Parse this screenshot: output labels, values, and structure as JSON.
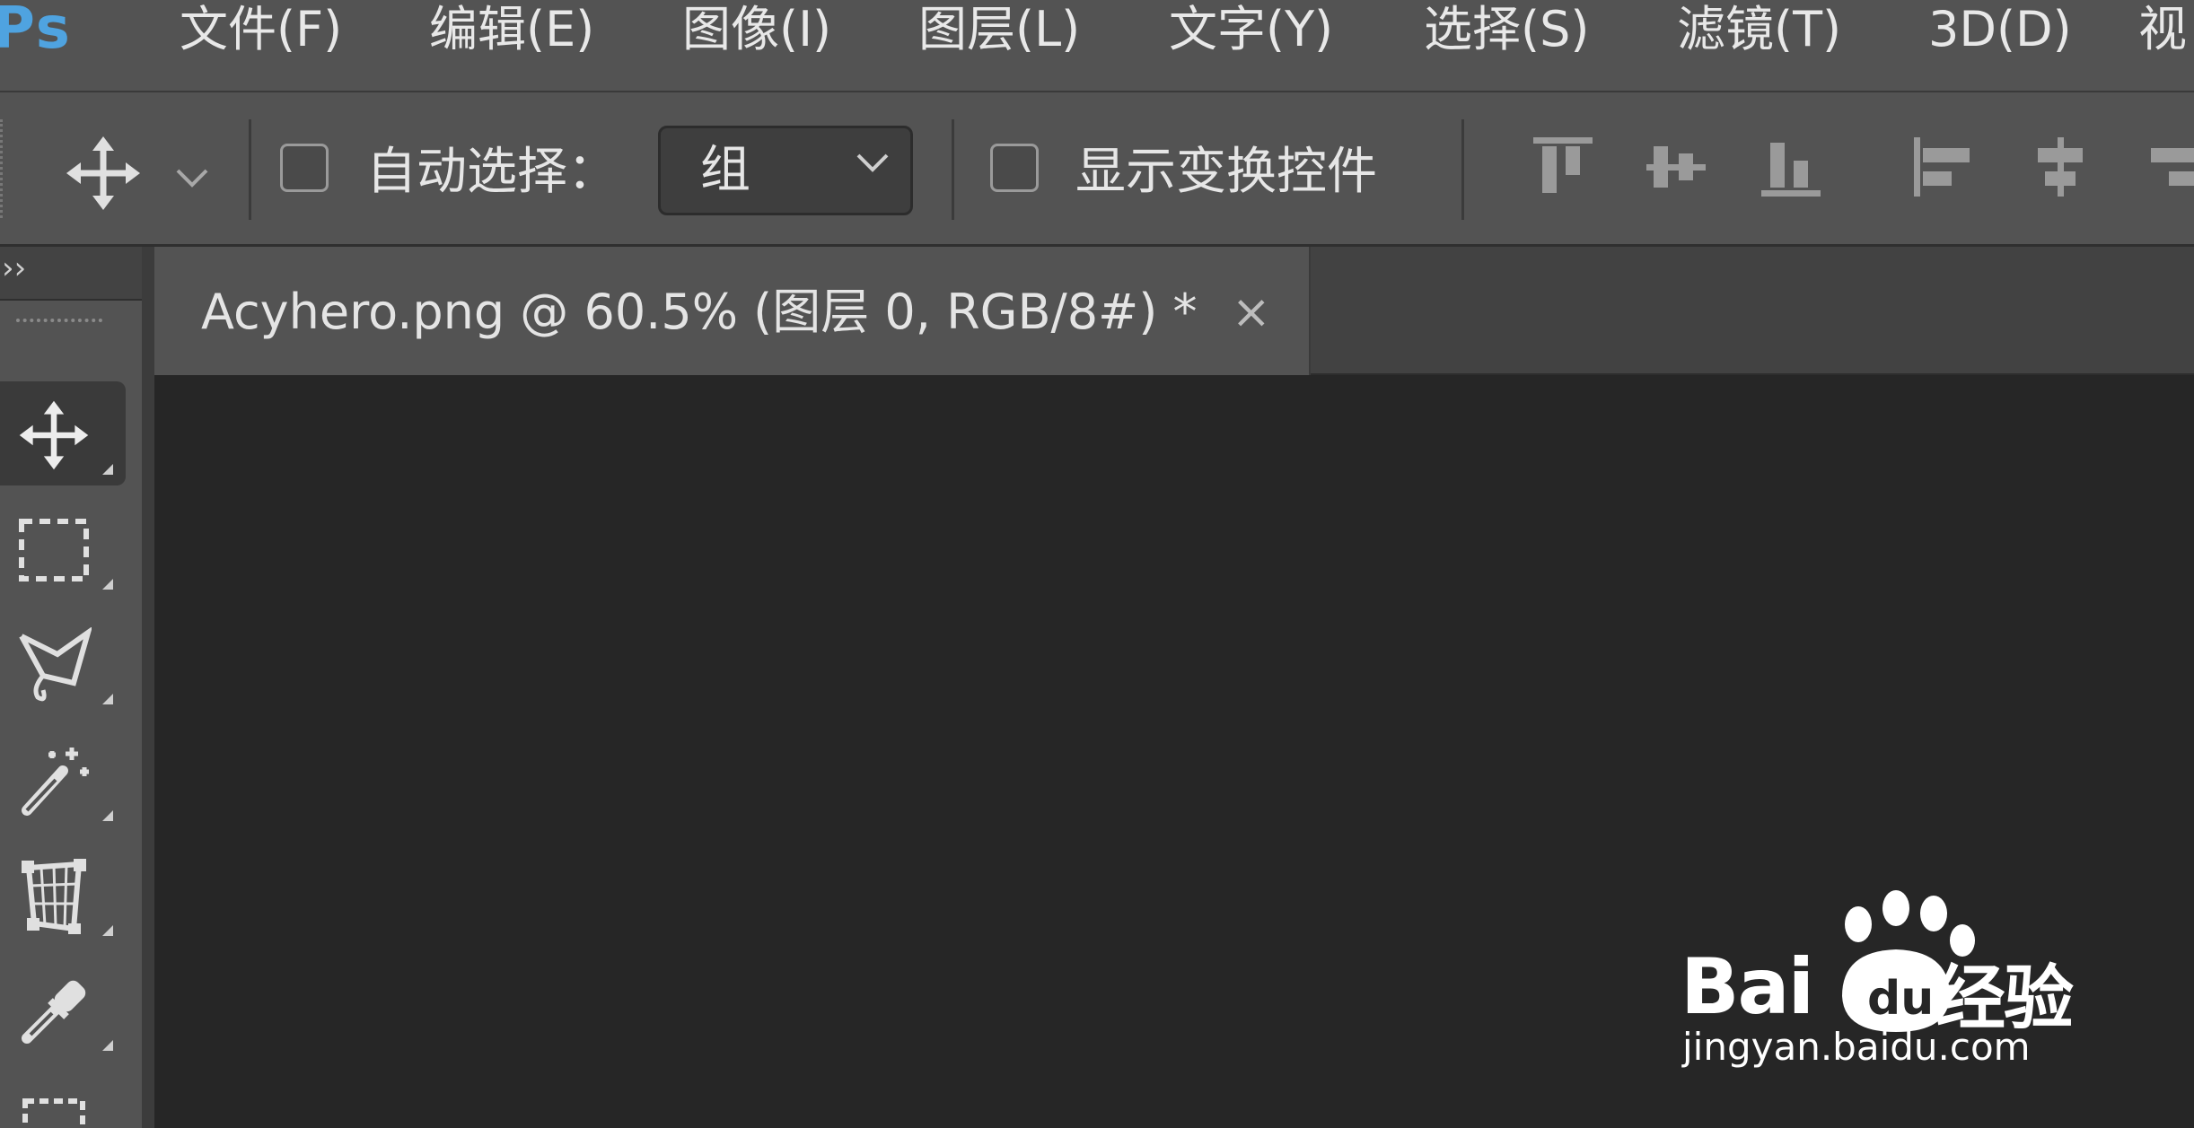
{
  "app": {
    "logo": "Ps"
  },
  "menu": [
    {
      "label": "文件(F)"
    },
    {
      "label": "编辑(E)"
    },
    {
      "label": "图像(I)"
    },
    {
      "label": "图层(L)"
    },
    {
      "label": "文字(Y)"
    },
    {
      "label": "选择(S)"
    },
    {
      "label": "滤镜(T)"
    },
    {
      "label": "3D(D)"
    },
    {
      "label": "视"
    }
  ],
  "options": {
    "auto_select_label": "自动选择：",
    "auto_select_checked": false,
    "auto_select_value": "组",
    "show_transform_label": "显示变换控件",
    "show_transform_checked": false
  },
  "document": {
    "tab_title": "Acyhero.png @ 60.5% (图层 0, RGB/8#) *",
    "close_glyph": "×"
  },
  "tools": [
    {
      "name": "move-tool",
      "icon": "move-icon",
      "active": true
    },
    {
      "name": "marquee-tool",
      "icon": "rect-marquee-icon",
      "active": false
    },
    {
      "name": "lasso-tool",
      "icon": "polygon-lasso-icon",
      "active": false
    },
    {
      "name": "magic-wand-tool",
      "icon": "magic-wand-icon",
      "active": false
    },
    {
      "name": "perspective-crop-tool",
      "icon": "perspective-crop-icon",
      "active": false
    },
    {
      "name": "eyedropper-tool",
      "icon": "eyedropper-icon",
      "active": false
    }
  ],
  "watermark": {
    "brand": "Bai",
    "brand_suffix": "经验",
    "url": "jingyan.baidu.com"
  },
  "colors": {
    "panel": "#535353",
    "canvas": "#262626",
    "ps_blue": "#4fa3e0"
  }
}
